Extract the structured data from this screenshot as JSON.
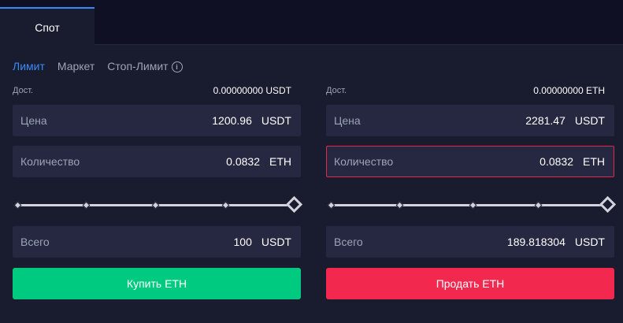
{
  "tabs": {
    "spot_label": "Спот"
  },
  "order_types": {
    "limit": "Лимит",
    "market": "Маркет",
    "stop_limit": "Стоп-Лимит",
    "info_glyph": "i"
  },
  "buy": {
    "available_label": "Дост.",
    "available_value": "0.00000000 USDT",
    "price_label": "Цена",
    "price_value": "1200.96",
    "price_unit": "USDT",
    "qty_label": "Количество",
    "qty_value": "0.0832",
    "qty_unit": "ETH",
    "slider_percent": 100,
    "total_label": "Всего",
    "total_value": "100",
    "total_unit": "USDT",
    "button_label": "Купить ETH"
  },
  "sell": {
    "available_label": "Дост.",
    "available_value": "0.00000000 ETH",
    "price_label": "Цена",
    "price_value": "2281.47",
    "price_unit": "USDT",
    "qty_label": "Количество",
    "qty_value": "0.0832",
    "qty_unit": "ETH",
    "slider_percent": 100,
    "total_label": "Всего",
    "total_value": "189.818304",
    "total_unit": "USDT",
    "button_label": "Продать ETH"
  },
  "colors": {
    "accent": "#3a8bf5",
    "buy": "#00c980",
    "sell": "#f2284f",
    "error_border": "#e0294d"
  }
}
